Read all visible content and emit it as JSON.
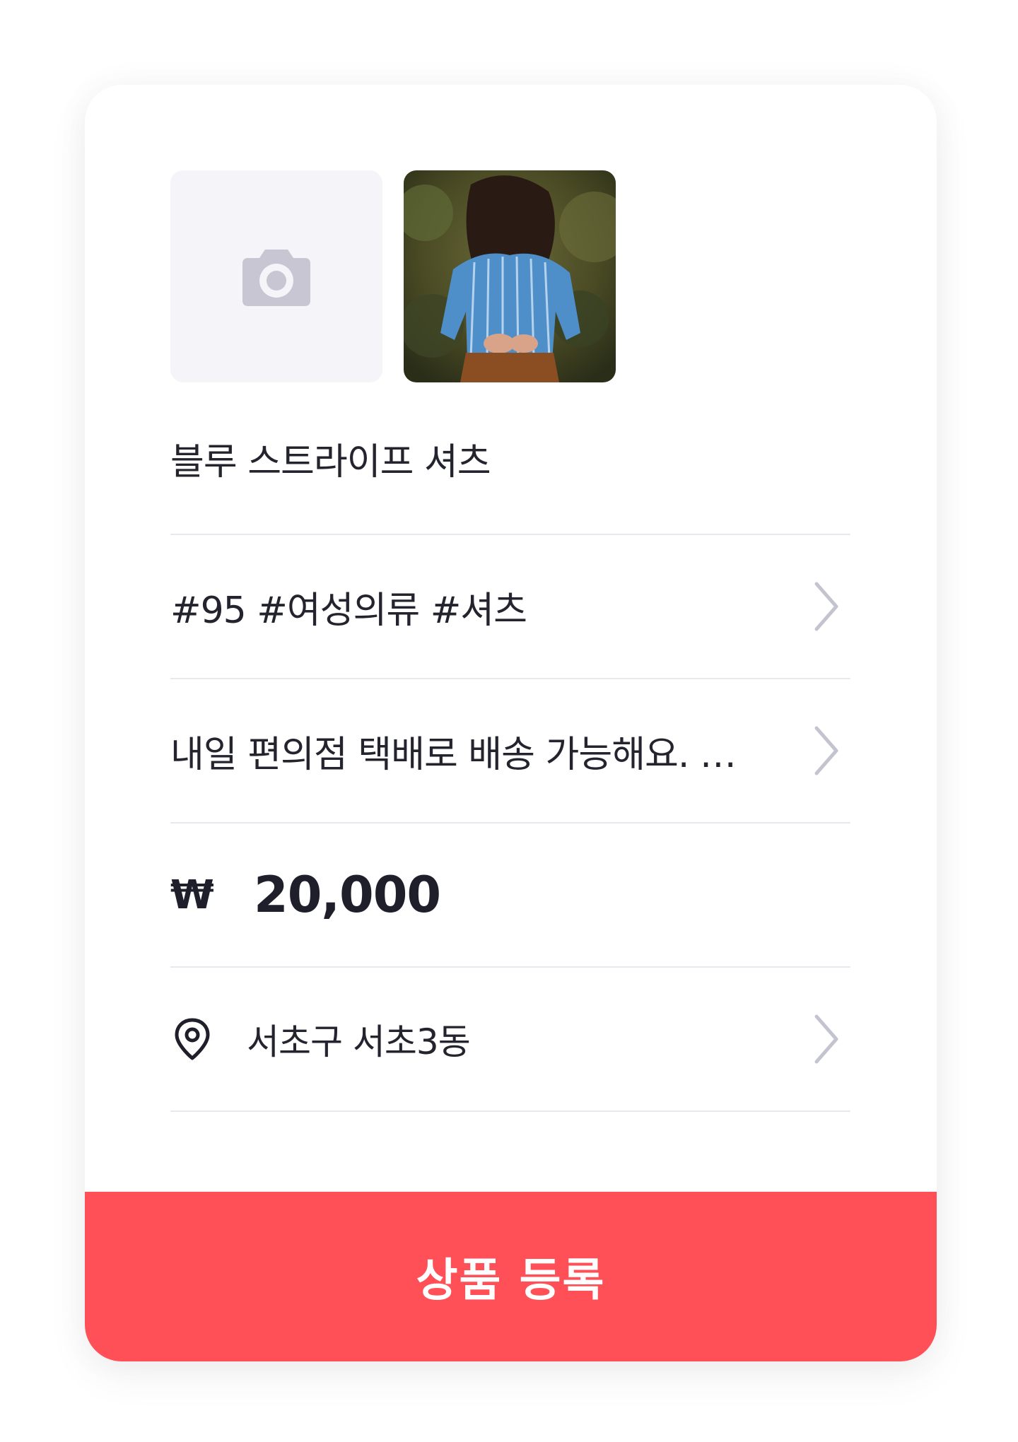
{
  "photos": {
    "add_icon": "camera-icon",
    "thumbnail_alt": "product-photo"
  },
  "form": {
    "title_value": "블루 스트라이프 셔츠",
    "tags_value": "#95 #여성의류 #셔츠",
    "description_value": "내일 편의점 택배로 배송 가능해요. …",
    "price": {
      "currency_symbol": "₩",
      "amount": "20,000"
    },
    "location": {
      "icon": "location-pin-icon",
      "value": "서초구 서초3동"
    }
  },
  "submit_button": {
    "label": "상품 등록"
  },
  "colors": {
    "accent": "#ff5058",
    "chevron": "#c4c4d0",
    "divider": "#e8e8ee",
    "photo_placeholder": "#f4f4f9",
    "camera_icon": "#c7c6d2"
  }
}
